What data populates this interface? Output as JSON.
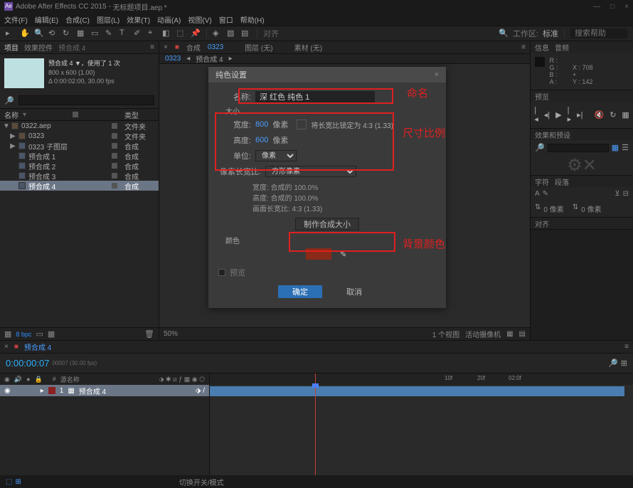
{
  "titlebar": {
    "app": "Adobe After Effects CC 2015",
    "doc": "无标题项目.aep *"
  },
  "menu": [
    "文件(F)",
    "编辑(E)",
    "合成(C)",
    "图层(L)",
    "效果(T)",
    "动画(A)",
    "视图(V)",
    "窗口",
    "帮助(H)"
  ],
  "toolbar_right": {
    "snap": "对齐",
    "workspace": "工作区:",
    "preset": "标准",
    "search_ph": "搜索帮助"
  },
  "left": {
    "tabs": {
      "project": "项目",
      "fx": "效果控件",
      "fx_target": "预合成 4"
    },
    "comp": {
      "name": "预合成 4 ▼，使用了 1 次",
      "dims": "800 x 600 (1.00)",
      "dur": "Δ 0:00:02:00, 30.00 fps"
    },
    "head": {
      "name": "名称",
      "type": "类型"
    },
    "items": [
      {
        "tri": "▼",
        "label": "0322.aep",
        "kind": "文件夹",
        "cls": "fold"
      },
      {
        "tri": "▶",
        "label": "0323",
        "kind": "文件夹",
        "cls": "fold"
      },
      {
        "tri": "▶",
        "label": "0323 子图层",
        "kind": "合成",
        "cls": "comp"
      },
      {
        "tri": "",
        "label": "预合成 1",
        "kind": "合成",
        "cls": "comp"
      },
      {
        "tri": "",
        "label": "预合成 2",
        "kind": "合成",
        "cls": "comp"
      },
      {
        "tri": "",
        "label": "预合成 3",
        "kind": "合成",
        "cls": "comp"
      },
      {
        "tri": "",
        "label": "预合成 4",
        "kind": "合成",
        "cls": "comp",
        "sel": true
      }
    ],
    "bpc": "8 bpc"
  },
  "mid": {
    "tabs": {
      "comp": "合成",
      "comp_name": "0323",
      "layer": "图层  (无)",
      "footage": "素材  (无)"
    },
    "sub": {
      "name": "0323",
      "crumb": "预合成 4"
    },
    "viewer_bar": {
      "zoom": "50%",
      "view": "1 个视图",
      "cam": "活动摄像机"
    }
  },
  "right": {
    "info_tab": "信息",
    "audio_tab": "音频",
    "info": {
      "R": "R :",
      "G": "G :",
      "B": "B :",
      "A": "A :",
      "X": "X :",
      "Y": "Y :",
      "xv": "708",
      "yv": "142",
      "plus": "+"
    },
    "preview_tab": "预览",
    "fx_tab": "效果和预设",
    "char_tab": "字符",
    "para_tab": "段落",
    "char": {
      "sizev": "0 像素",
      "leadv": "0 像素"
    },
    "align_tab": "对齐"
  },
  "timeline": {
    "comp": "预合成 4",
    "time": "0:00:00:07",
    "fps": "00007 (30.00 fps)",
    "cols": {
      "src": "源名称"
    },
    "layer": {
      "num": "1",
      "name": "预合成 4"
    },
    "ruler": {
      "t1": "10f",
      "t2": "20f",
      "t3": "02:0f"
    }
  },
  "footer": {
    "switch": "切换开关/模式"
  },
  "dialog": {
    "title": "纯色设置",
    "name_lab": "名称:",
    "name_val": "深 红色 纯色 1",
    "size_lab": "大小",
    "width_lab": "宽度:",
    "width_val": "800",
    "px": "像素",
    "height_lab": "高度:",
    "height_val": "600",
    "lock_lab": "将长宽比锁定为 4:3 (1.33)",
    "unit_lab": "单位:",
    "unit_val": "像素",
    "par_lab": "像素长宽比:",
    "par_val": "方形像素",
    "w_info": "宽度: 合成的 100.0%",
    "h_info": "高度: 合成的 100.0%",
    "ar_info": "画面长宽比: 4:3 (1.33)",
    "make_btn": "制作合成大小",
    "color_lab": "颜色",
    "preview_lab": "预览",
    "ok": "确定",
    "cancel": "取消"
  },
  "anno": {
    "name": "命名",
    "size": "尺寸比例",
    "color": "背景颜色"
  }
}
